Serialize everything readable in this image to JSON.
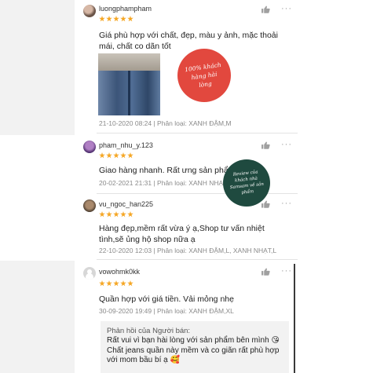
{
  "reviews": [
    {
      "username": "luongphampham",
      "rating": 5,
      "text": "Giá phù hợp với chất, đẹp, màu y ảnh, mặc thoải mái, chất co dãn tốt",
      "meta": "21-10-2020 08:24 | Phân loại: XANH ĐẬM,M"
    },
    {
      "username": "pham_nhu_y.123",
      "rating": 5,
      "text": "Giao hàng nhanh. Rất ưng sản phẩm",
      "meta": "20-02-2021 21:31 | Phân loại: XANH NHẠT,L"
    },
    {
      "username": "vu_ngoc_han225",
      "rating": 5,
      "text": "Hàng đẹp,mềm rất vừa ý ạ,Shop tư vấn nhiệt tình,sẽ ủng hộ shop nữa ạ",
      "meta": "22-10-2020 12:03 | Phân loại: XANH ĐẬM,L, XANH NHẠT,L"
    },
    {
      "username": "vowohmk0kk",
      "rating": 5,
      "text": "Quần hợp với giá tiền. Vải mỏng nhẹ",
      "meta": "30-09-2020 19:49 | Phân loại: XANH ĐẬM,XL"
    }
  ],
  "seller_reply": {
    "title": "Phản hồi của Người bán:",
    "text": "Rất vui vì bạn hài lòng với sản phẩm bên mình 😘 Chất jeans quần này mềm và co giãn rất phù hợp với mom bầu bí ạ 🥰"
  },
  "badges": {
    "red": "100% khách hàng hài lòng",
    "green": "Review của khách nhà Samsam về sản phẩm"
  },
  "icons": {
    "like": "thumbs-up-icon",
    "more": "more-options-icon"
  },
  "colors": {
    "star": "#f5a623",
    "red_badge": "#e2483e",
    "green_badge": "#1f4a3f"
  }
}
